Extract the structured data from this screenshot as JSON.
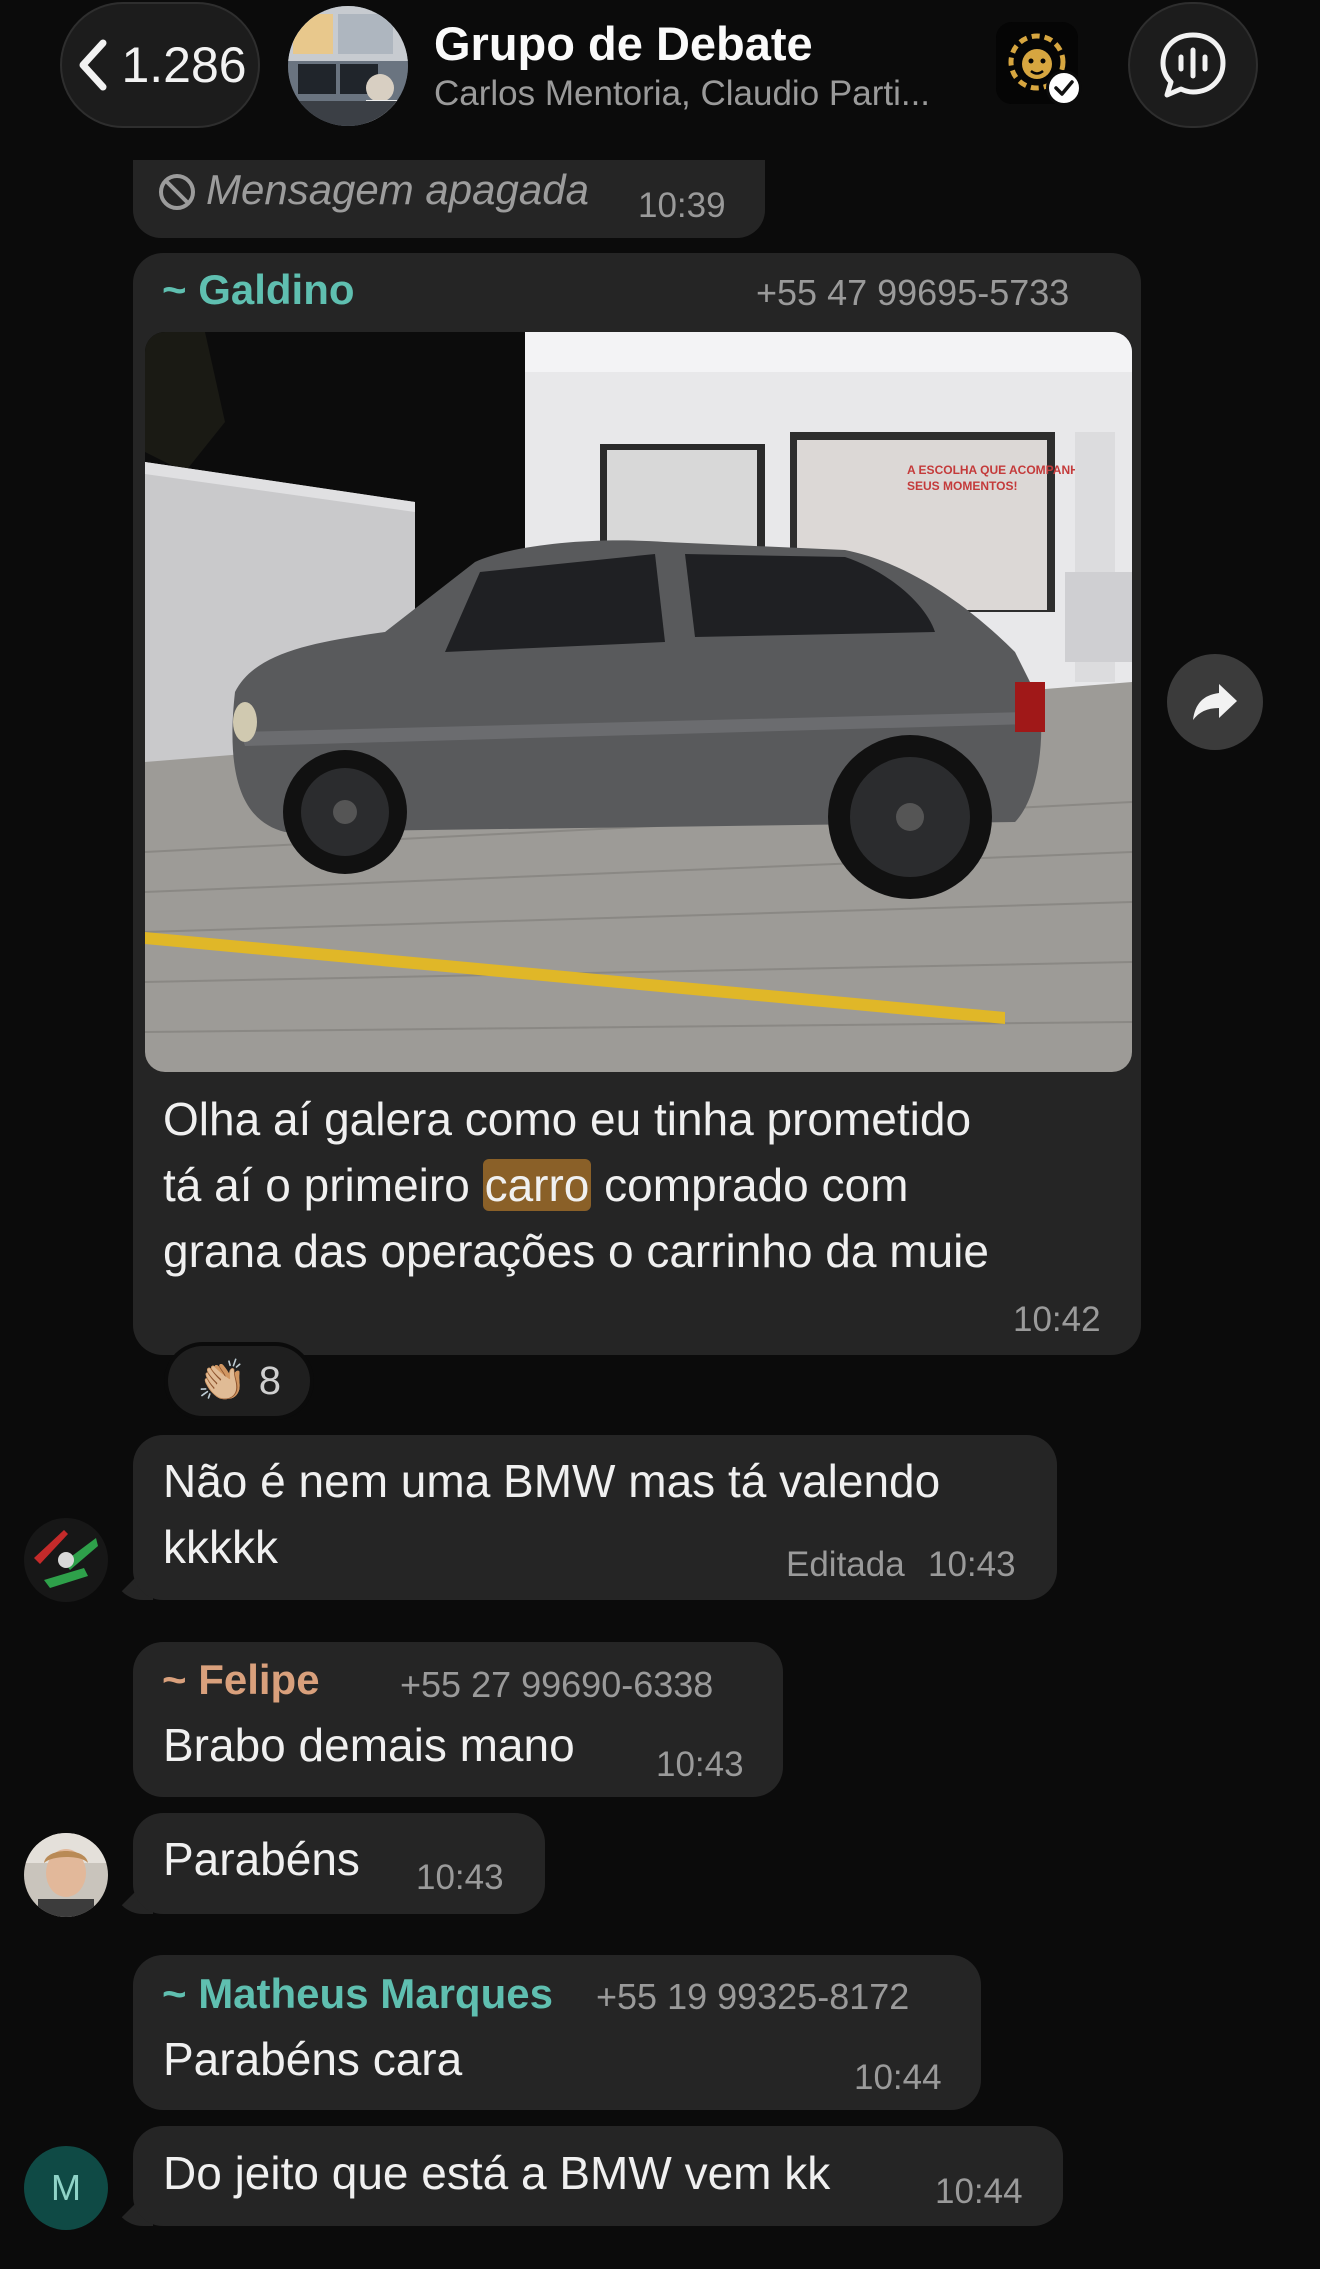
{
  "header": {
    "back_count": "1.286",
    "title": "Grupo de Debate",
    "subtitle": "Carlos Mentoria, Claudio Parti..."
  },
  "messages": {
    "deleted": {
      "text": "Mensagem apagada",
      "time": "10:39"
    },
    "photo_msg": {
      "sender": "~ Galdino",
      "phone": "+55 47 99695-5733",
      "line1": "Olha aí galera como eu tinha prometido",
      "line2_pre": "tá aí o primeiro ",
      "line2_hl": "carro",
      "line2_post": " comprado com",
      "line3": "grana das operações o carrinho da muie",
      "time": "10:42",
      "reaction_emoji": "👏🏼",
      "reaction_count": "8"
    },
    "bmw": {
      "line1": "Não é nem uma BMW mas tá valendo",
      "line2": "kkkkk",
      "edited": "Editada",
      "time": "10:43"
    },
    "felipe": {
      "sender": "~ Felipe",
      "phone": "+55 27 99690-6338",
      "text": "Brabo demais mano",
      "time": "10:43"
    },
    "parabens": {
      "text": "Parabéns",
      "time": "10:43"
    },
    "matheus": {
      "sender": "~ Matheus Marques",
      "phone": "+55 19 99325-8172",
      "text": "Parabéns cara",
      "time": "10:44"
    },
    "jeito": {
      "avatar_letter": "M",
      "text": "Do jeito que está a BMW vem kk",
      "time": "10:44"
    }
  },
  "colors": {
    "background": "#0b0b0b",
    "bubble": "#252525",
    "galdino_name": "#5fbfb0",
    "felipe_name": "#d9a07c",
    "matheus_name": "#5fbfb0",
    "highlight": "#8a6028"
  },
  "icons": [
    "chevron-left-icon",
    "voice-chat-icon",
    "forward-icon",
    "no-entry-icon",
    "check-icon",
    "lion-icon"
  ]
}
